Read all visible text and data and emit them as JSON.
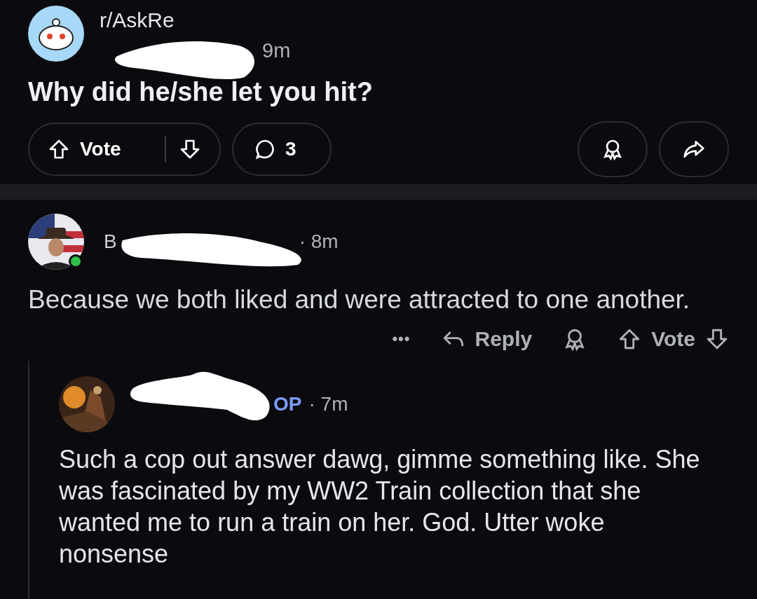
{
  "post": {
    "subreddit": "r/AskRe",
    "time": "9m",
    "title": "Why did he/she let you hit?",
    "vote_label": "Vote",
    "comment_count": "3"
  },
  "comments": [
    {
      "author": "B",
      "time": "· 8m",
      "online": true,
      "body": "Because we both liked and were attracted to one another.",
      "more": "•••",
      "reply_label": "Reply",
      "vote_label": "Vote",
      "children": [
        {
          "badge": "OP",
          "time": "· 7m",
          "body": "Such a cop out answer dawg, gimme something like. She was fascinated by my WW2 Train collection that she wanted me to run a train on her. God. Utter woke nonsense"
        }
      ]
    }
  ]
}
